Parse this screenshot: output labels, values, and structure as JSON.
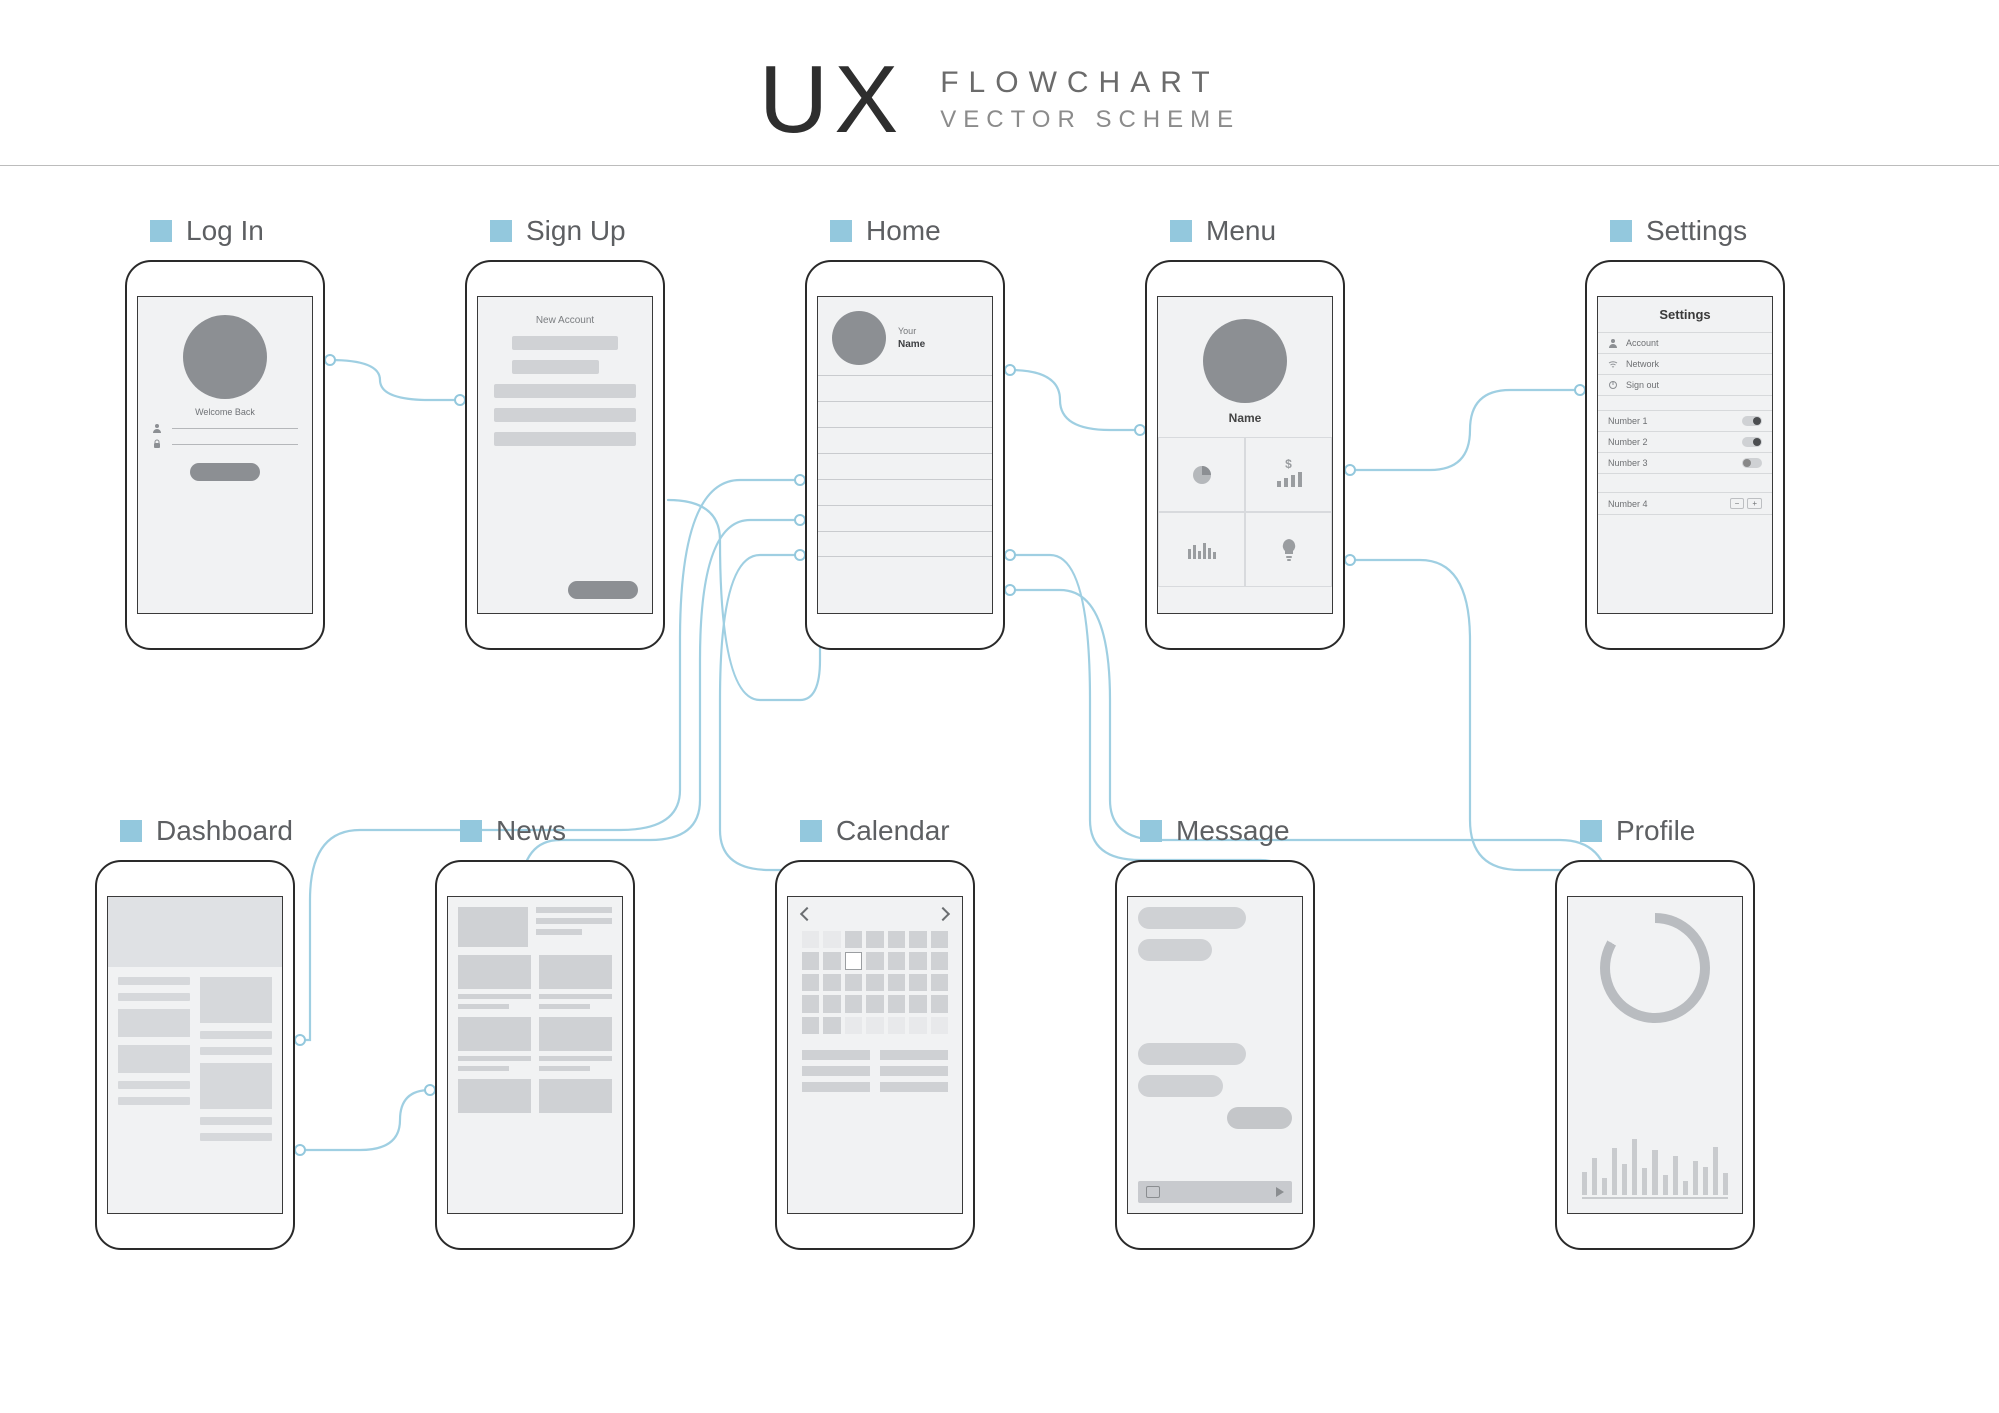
{
  "header": {
    "logo": "UX",
    "line1": "FLOWCHART",
    "line2": "VECTOR SCHEME"
  },
  "colors": {
    "accent": "#93c8dd",
    "phone_fill": "#f1f2f3",
    "mid_grey": "#8c8f93"
  },
  "screens": {
    "login": {
      "label": "Log In",
      "welcome": "Welcome Back"
    },
    "signup": {
      "label": "Sign Up",
      "title": "New Account"
    },
    "home": {
      "label": "Home",
      "line1": "Your",
      "line2": "Name"
    },
    "menu": {
      "label": "Menu",
      "name": "Name",
      "icons": [
        "pie-chart-icon",
        "bar-growth-icon",
        "bars-icon",
        "lightbulb-icon"
      ],
      "dollar": "$"
    },
    "settings": {
      "label": "Settings",
      "title": "Settings",
      "links": [
        "Account",
        "Network",
        "Sign out"
      ],
      "toggles": [
        "Number 1",
        "Number 2",
        "Number 3"
      ],
      "stepper": "Number 4"
    },
    "dashboard": {
      "label": "Dashboard"
    },
    "news": {
      "label": "News"
    },
    "calendar": {
      "label": "Calendar"
    },
    "message": {
      "label": "Message"
    },
    "profile": {
      "label": "Profile"
    }
  },
  "profile_bars": [
    30,
    48,
    22,
    60,
    40,
    72,
    34,
    58,
    26,
    50,
    18,
    44,
    36,
    62,
    28
  ],
  "connectors": [
    [
      "login",
      "signup",
      "bidir"
    ],
    [
      "signup",
      "home",
      "to"
    ],
    [
      "home",
      "menu",
      "bidir"
    ],
    [
      "menu",
      "settings",
      "bidir"
    ],
    [
      "home",
      "dashboard",
      "bidir"
    ],
    [
      "home",
      "news",
      "bidir"
    ],
    [
      "home",
      "calendar",
      "bidir"
    ],
    [
      "home",
      "message",
      "bidir"
    ],
    [
      "home",
      "profile",
      "bidir"
    ],
    [
      "menu",
      "profile",
      "bidir"
    ]
  ]
}
